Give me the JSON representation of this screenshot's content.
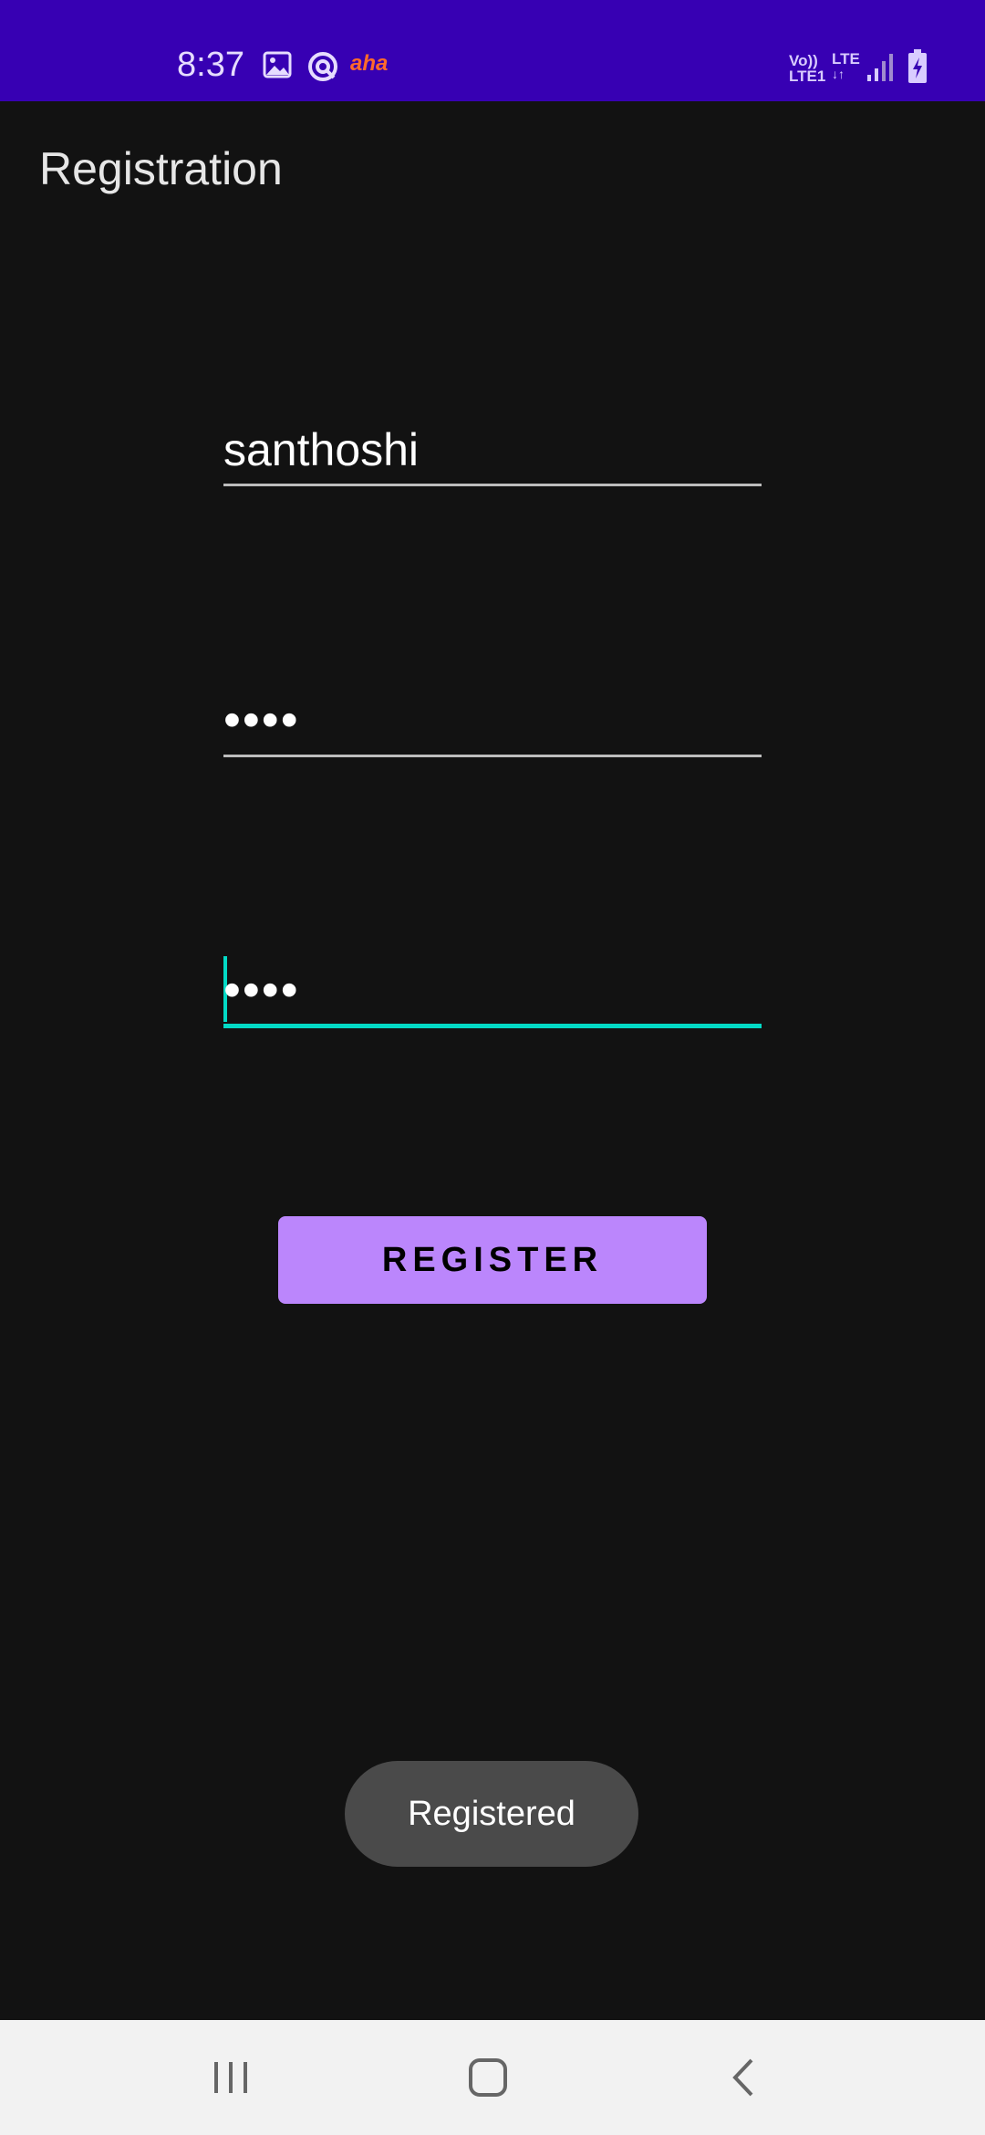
{
  "status_bar": {
    "time": "8:37",
    "icons": [
      "image-icon",
      "circle-app-icon",
      "aha-app-icon",
      "volte-icon",
      "lte-icon",
      "signal-icon",
      "battery-charging-icon"
    ],
    "aha_label": "aha",
    "volte_label_top": "Vo))",
    "volte_label_bottom": "LTE1",
    "lte_label": "LTE"
  },
  "app_bar": {
    "title": "Registration"
  },
  "form": {
    "username_value": "santhoshi",
    "password_value": "••••",
    "confirm_password_value": "••••",
    "register_label": "REGISTER"
  },
  "toast": {
    "message": "Registered"
  },
  "nav_bar": {
    "icons": [
      "recents-icon",
      "home-icon",
      "back-icon"
    ]
  },
  "colors": {
    "status_bar": "#3700b3",
    "background": "#121212",
    "accent_focus": "#03dac6",
    "button": "#bb86fc"
  }
}
